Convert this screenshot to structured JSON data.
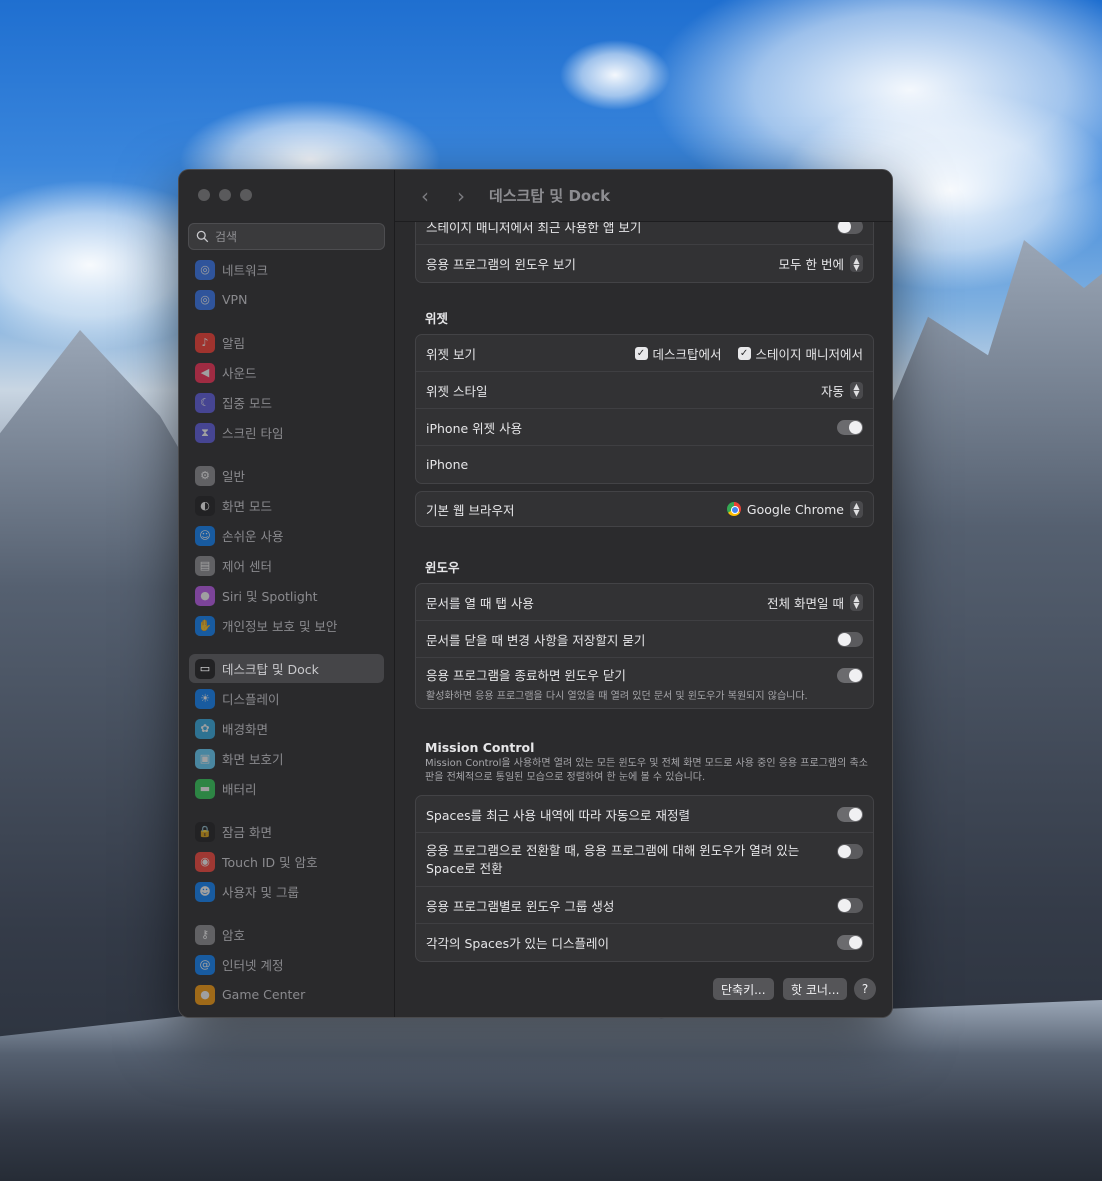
{
  "window": {
    "title": "데스크탑 및 Dock"
  },
  "search": {
    "placeholder": "검색"
  },
  "sidebar": {
    "items": [
      {
        "label": "네트워크",
        "icon": "globe-icon",
        "color": "#3478f6"
      },
      {
        "label": "VPN",
        "icon": "vpn-globe-icon",
        "color": "#3478f6"
      },
      {
        "label": "알림",
        "icon": "bell-icon",
        "color": "#ff3b30"
      },
      {
        "label": "사운드",
        "icon": "speaker-icon",
        "color": "#ff2d55"
      },
      {
        "label": "집중 모드",
        "icon": "moon-icon",
        "color": "#5e5ce6"
      },
      {
        "label": "스크린 타임",
        "icon": "hourglass-icon",
        "color": "#5e5ce6"
      },
      {
        "label": "일반",
        "icon": "gear-icon",
        "color": "#8e8e93"
      },
      {
        "label": "화면 모드",
        "icon": "appearance-icon",
        "color": "#1c1c1e"
      },
      {
        "label": "손쉬운 사용",
        "icon": "accessibility-icon",
        "color": "#0a84ff"
      },
      {
        "label": "제어 센터",
        "icon": "control-center-icon",
        "color": "#8e8e93"
      },
      {
        "label": "Siri 및 Spotlight",
        "icon": "siri-icon",
        "color": "#bf5af2"
      },
      {
        "label": "개인정보 보호 및 보안",
        "icon": "hand-icon",
        "color": "#0a84ff"
      },
      {
        "label": "데스크탑 및 Dock",
        "icon": "dock-icon",
        "color": "#1c1c1e"
      },
      {
        "label": "디스플레이",
        "icon": "sun-icon",
        "color": "#0a84ff"
      },
      {
        "label": "배경화면",
        "icon": "wallpaper-icon",
        "color": "#32ade6"
      },
      {
        "label": "화면 보호기",
        "icon": "screensaver-icon",
        "color": "#64d2ff"
      },
      {
        "label": "배터리",
        "icon": "battery-icon",
        "color": "#30d158"
      },
      {
        "label": "잠금 화면",
        "icon": "lock-icon",
        "color": "#1c1c1e"
      },
      {
        "label": "Touch ID 및 암호",
        "icon": "fingerprint-icon",
        "color": "#ff453a"
      },
      {
        "label": "사용자 및 그룹",
        "icon": "users-icon",
        "color": "#0a84ff"
      },
      {
        "label": "암호",
        "icon": "key-icon",
        "color": "#8e8e93"
      },
      {
        "label": "인터넷 계정",
        "icon": "at-icon",
        "color": "#0a84ff"
      },
      {
        "label": "Game Center",
        "icon": "game-center-icon",
        "color": "#ff9f0a"
      }
    ]
  },
  "top_partial": {
    "label": "스테이지 매니저에서 최근 사용한 앱 보기",
    "on": false
  },
  "app_windows": {
    "label": "응용 프로그램의 윈도우 보기",
    "value": "모두 한 번에"
  },
  "widgets": {
    "heading": "위젯",
    "show_label": "위젯 보기",
    "show_desktop": "데스크탑에서",
    "show_stage": "스테이지 매니저에서",
    "style_label": "위젯 스타일",
    "style_value": "자동",
    "iphone_label": "iPhone 위젯 사용",
    "iphone_on": true,
    "iphone_device": "iPhone"
  },
  "browser": {
    "label": "기본 웹 브라우저",
    "value": "Google Chrome"
  },
  "windows": {
    "heading": "윈도우",
    "tabs_label": "문서를 열 때 탭 사용",
    "tabs_value": "전체 화면일 때",
    "ask_save_label": "문서를 닫을 때 변경 사항을 저장할지 묻기",
    "ask_save_on": false,
    "close_windows_label": "응용 프로그램을 종료하면 윈도우 닫기",
    "close_windows_desc": "활성화하면 응용 프로그램을 다시 열었을 때 열려 있던 문서 및 윈도우가 복원되지 않습니다.",
    "close_windows_on": true
  },
  "mission_control": {
    "heading": "Mission Control",
    "desc": "Mission Control을 사용하면 열려 있는 모든 윈도우 및 전체 화면 모드로 사용 중인 응용 프로그램의 축소판을 전체적으로 통일된 모습으로 정렬하여 한 눈에 볼 수 있습니다.",
    "rearrange_label": "Spaces를 최근 사용 내역에 따라 자동으로 재정렬",
    "rearrange_on": true,
    "switch_label_1": "응용 프로그램으로 전환할 때, 응용 프로그램에 대해 윈도우가 열려 있는",
    "switch_label_2": "Space로 전환",
    "switch_on": false,
    "group_label": "응용 프로그램별로 윈도우 그룹 생성",
    "group_on": false,
    "separate_label": "각각의 Spaces가 있는 디스플레이",
    "separate_on": true
  },
  "buttons": {
    "shortcuts": "단축키...",
    "hot_corners": "핫 코너...",
    "help": "?"
  }
}
